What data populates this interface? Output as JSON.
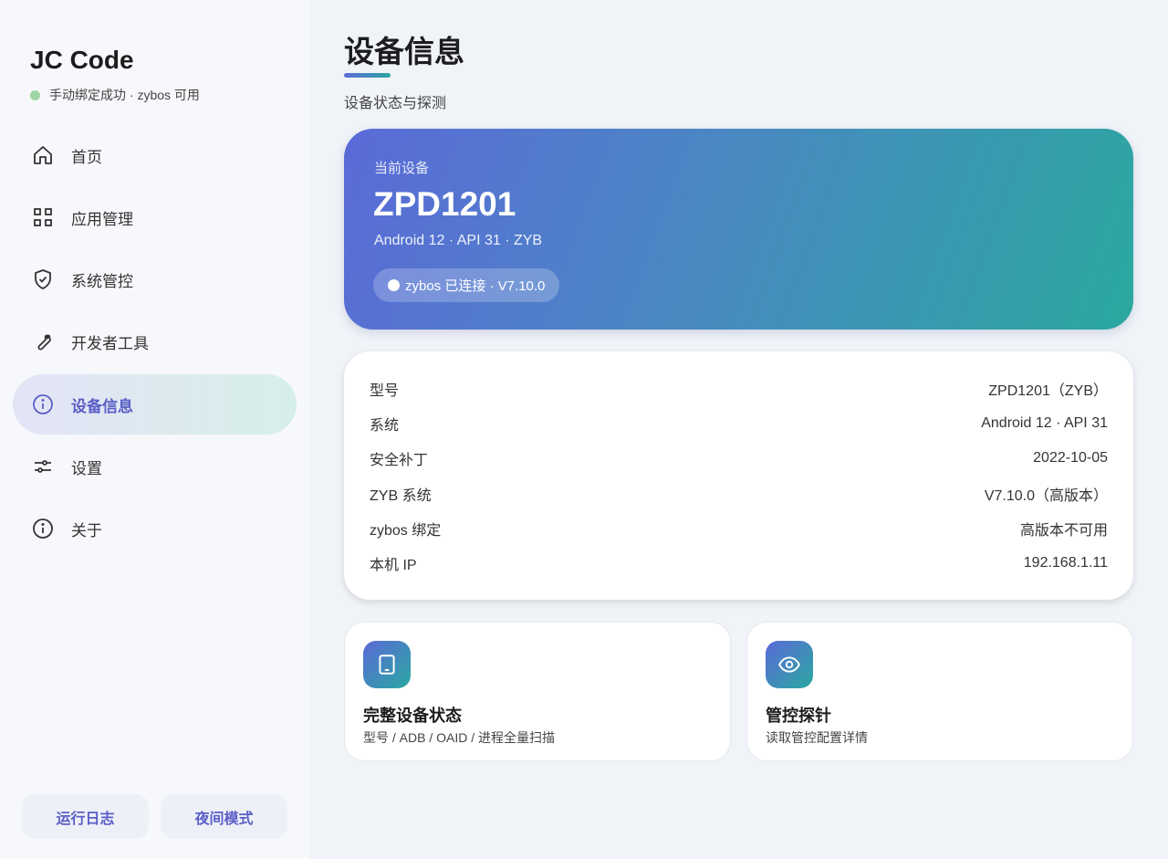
{
  "sidebar": {
    "brand": "JC Code",
    "status": "手动绑定成功 · zybos 可用",
    "items": [
      {
        "label": "首页",
        "icon": "home-icon"
      },
      {
        "label": "应用管理",
        "icon": "grid-icon"
      },
      {
        "label": "系统管控",
        "icon": "shield-icon"
      },
      {
        "label": "开发者工具",
        "icon": "wrench-icon"
      },
      {
        "label": "设备信息",
        "icon": "info-icon",
        "active": true
      },
      {
        "label": "设置",
        "icon": "sliders-icon"
      },
      {
        "label": "关于",
        "icon": "info-icon"
      }
    ],
    "footer": {
      "log_label": "运行日志",
      "night_label": "夜间模式"
    }
  },
  "main": {
    "title": "设备信息",
    "subtitle": "设备状态与探测",
    "hero": {
      "label": "当前设备",
      "name": "ZPD1201",
      "system": "Android 12 · API 31 · ZYB",
      "chip": "zybos 已连接 · V7.10.0"
    },
    "info": [
      {
        "key": "型号",
        "value": "ZPD1201（ZYB）"
      },
      {
        "key": "系统",
        "value": "Android 12 · API 31"
      },
      {
        "key": "安全补丁",
        "value": "2022-10-05"
      },
      {
        "key": "ZYB 系统",
        "value": "V7.10.0（高版本）"
      },
      {
        "key": "zybos 绑定",
        "value": "高版本不可用"
      },
      {
        "key": "本机 IP",
        "value": "192.168.1.11"
      }
    ],
    "actions": [
      {
        "title": "完整设备状态",
        "desc": "型号 / ADB / OAID / 进程全量扫描",
        "icon": "tablet-icon"
      },
      {
        "title": "管控探针",
        "desc": "读取管控配置详情",
        "icon": "eye-icon"
      }
    ]
  },
  "colors": {
    "accent": "#5a5fc6",
    "gradient_start": "#5b6ad8",
    "gradient_end": "#2aa8a0",
    "status_dot": "#9fd4a6"
  }
}
